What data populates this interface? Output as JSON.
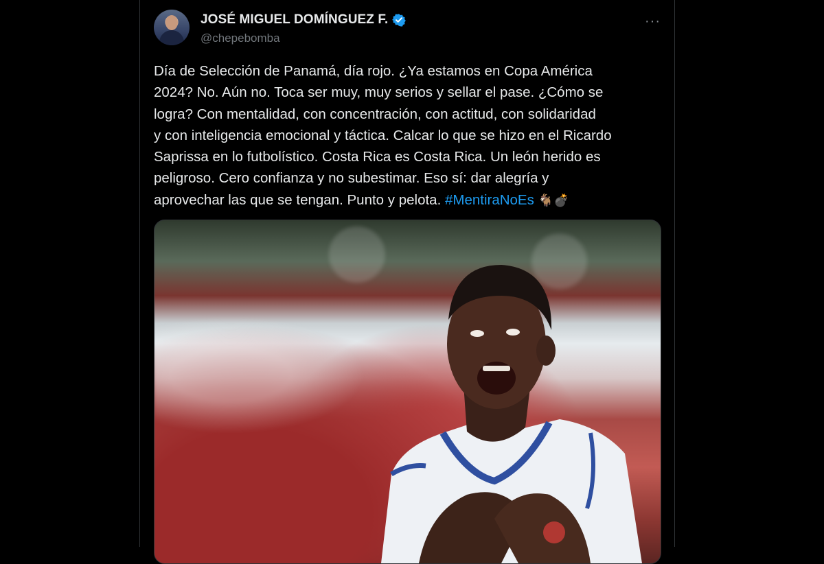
{
  "tweet": {
    "author_name": "JOSÉ MIGUEL DOMÍNGUEZ F.",
    "author_handle": "@chepebomba",
    "more_label": "···",
    "text_lines": [
      "Día de Selección de Panamá, día rojo. ¿Ya estamos en Copa América",
      "2024? No. Aún no. Toca ser muy, muy serios y sellar el pase. ¿Cómo se",
      "logra? Con mentalidad, con concentración, con actitud, con solidaridad",
      "y con inteligencia emocional y táctica. Calcar lo que se hizo en el Ricardo",
      "Saprissa en lo futbolístico. Costa Rica es Costa Rica. Un león herido es",
      "peligroso. Cero confianza y no subestimar. Eso sí: dar alegría y"
    ],
    "last_line_text": "aprovechar las que se tengan. Punto y pelota. ",
    "hashtag": "#MentiraNoEs",
    "emojis": "🐐💣"
  },
  "colors": {
    "background": "#000000",
    "text": "#e7e9ea",
    "secondary": "#71767b",
    "accent": "#1d9bf0"
  },
  "icons": {
    "verified": "verified-badge-icon",
    "more": "more-options-icon"
  }
}
